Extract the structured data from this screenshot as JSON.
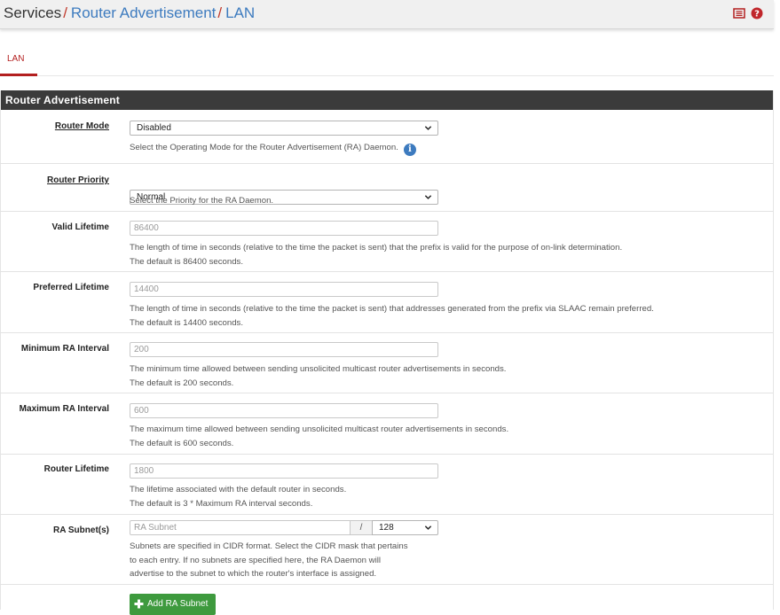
{
  "breadcrumb": {
    "root": "Services",
    "sep": "/",
    "item1": "Router Advertisement",
    "item2": "LAN"
  },
  "header_icons": [
    "list-icon",
    "help-icon"
  ],
  "tabs": [
    {
      "label": "LAN",
      "active": true
    }
  ],
  "panel": {
    "title": "Router Advertisement"
  },
  "fields": {
    "router_mode": {
      "label": "Router Mode",
      "value": "Disabled",
      "help": "Select the Operating Mode for the Router Advertisement (RA) Daemon."
    },
    "router_priority": {
      "label": "Router Priority",
      "value": "Normal",
      "help": "Select the Priority for the RA Daemon."
    },
    "valid_lifetime": {
      "label": "Valid Lifetime",
      "placeholder": "86400",
      "help1": "The length of time in seconds (relative to the time the packet is sent) that the prefix is valid for the purpose of on-link determination.",
      "help2": "The default is 86400 seconds."
    },
    "preferred_lifetime": {
      "label": "Preferred Lifetime",
      "placeholder": "14400",
      "help1": "The length of time in seconds (relative to the time the packet is sent) that addresses generated from the prefix via SLAAC remain preferred.",
      "help2": "The default is 14400 seconds."
    },
    "min_ra_interval": {
      "label": "Minimum RA Interval",
      "placeholder": "200",
      "help1": "The minimum time allowed between sending unsolicited multicast router advertisements in seconds.",
      "help2": "The default is 200 seconds."
    },
    "max_ra_interval": {
      "label": "Maximum RA Interval",
      "placeholder": "600",
      "help1": "The maximum time allowed between sending unsolicited multicast router advertisements in seconds.",
      "help2": "The default is 600 seconds."
    },
    "router_lifetime": {
      "label": "Router Lifetime",
      "placeholder": "1800",
      "help1": "The lifetime associated with the default router in seconds.",
      "help2": "The default is 3 * Maximum RA interval seconds."
    },
    "ra_subnets": {
      "label": "RA Subnet(s)",
      "placeholder": "RA Subnet",
      "slash": "/",
      "cidr": "128",
      "help1": "Subnets are specified in CIDR format. Select the CIDR mask that pertains",
      "help2": "to each entry. If no subnets are specified here, the RA Daemon will",
      "help3": "advertise to the subnet to which the router's interface is assigned."
    }
  },
  "buttons": {
    "add_subnet": "Add RA Subnet"
  },
  "colors": {
    "link": "#3d7bbf",
    "accent_red": "#b31f1f",
    "panel_header": "#3b3b3b",
    "success": "#3e9a3e"
  }
}
